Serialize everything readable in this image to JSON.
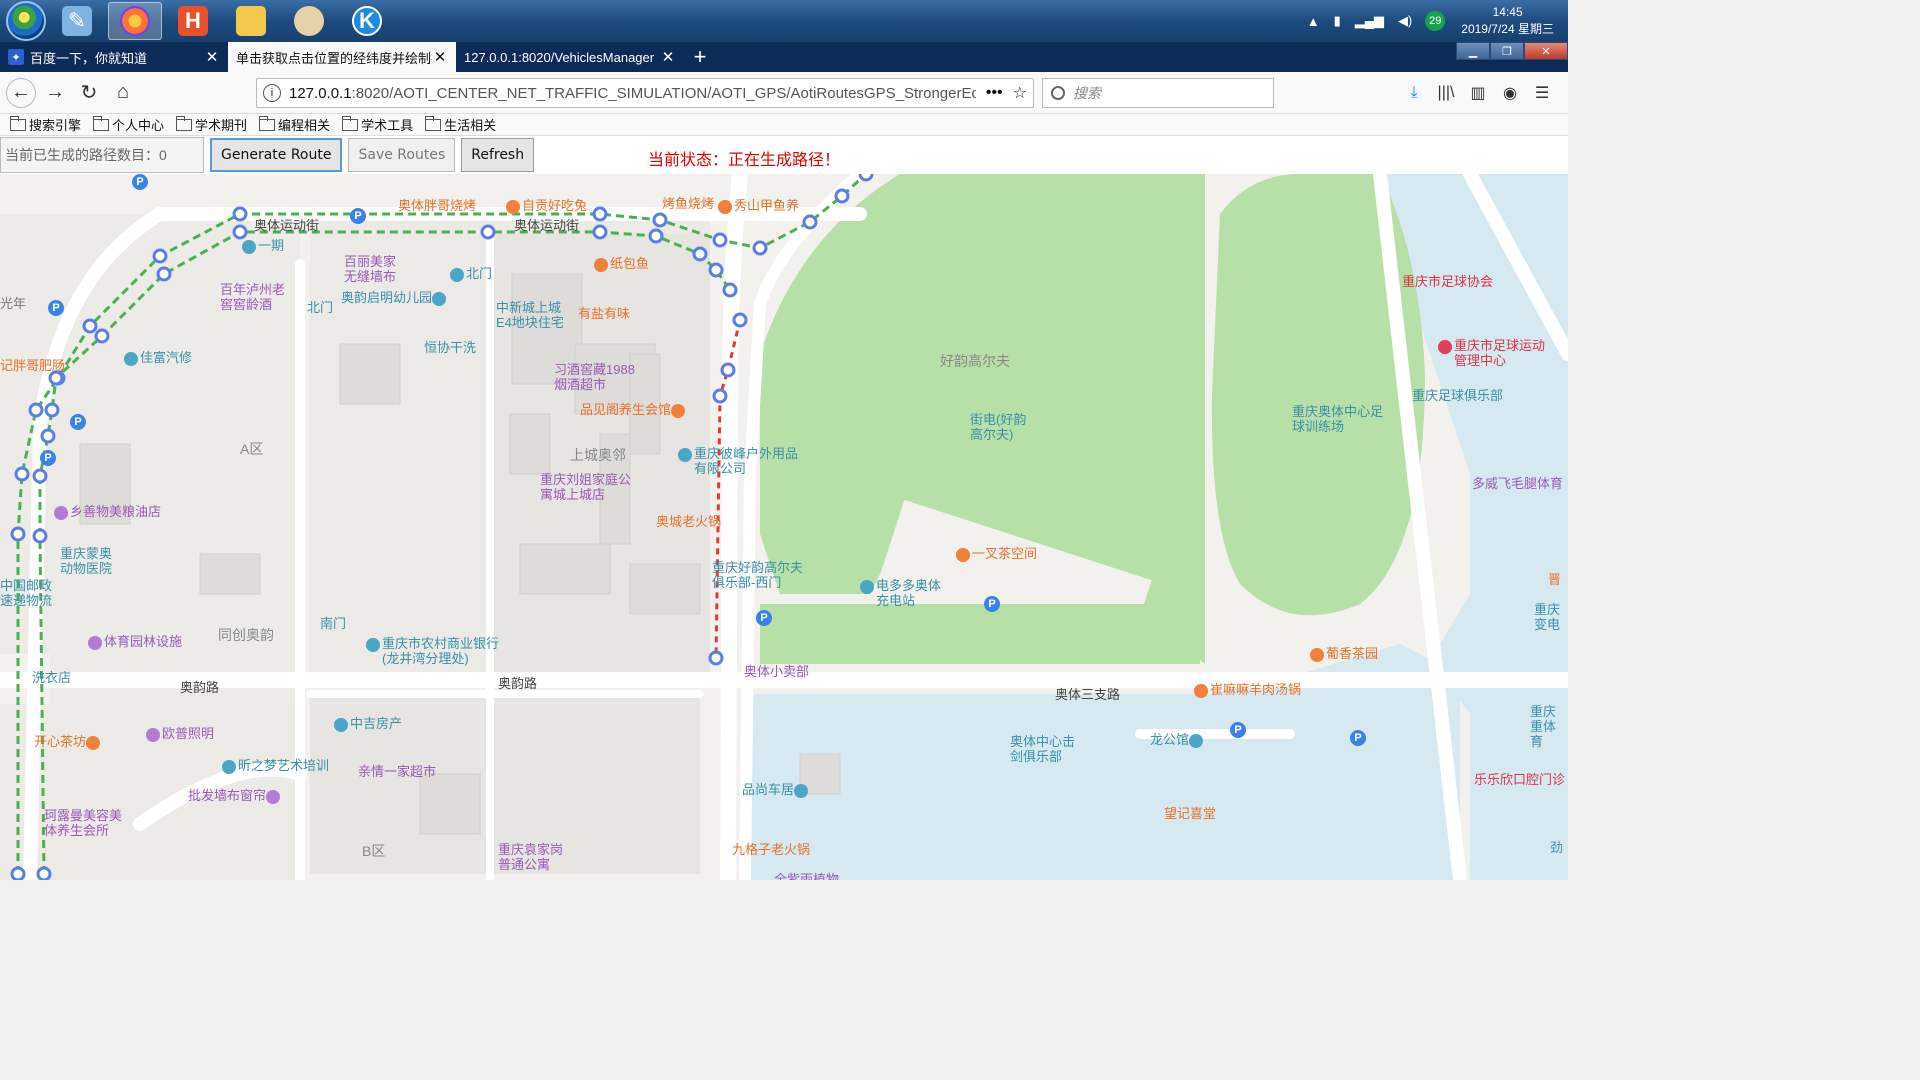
{
  "taskbar": {
    "clock_time": "14:45",
    "clock_date": "2019/7/24 星期三",
    "notification_count": "29",
    "apps": [
      "notepad",
      "firefox",
      "hbuilder",
      "file-explorer",
      "paint",
      "kuaizip"
    ]
  },
  "tabs": [
    {
      "label": "百度一下，你就知道",
      "favicon": "baidu-paw-icon"
    },
    {
      "label": "单击获取点击位置的经纬度并绘制折线",
      "favicon": ""
    },
    {
      "label": "127.0.0.1:8020/VehiclesManager",
      "favicon": ""
    }
  ],
  "nav": {
    "url_host": "127.0.0.1",
    "url_rest": ":8020/AOTI_CENTER_NET_TRAFFIC_SIMULATION/AOTI_GPS/AotiRoutesGPS_StrongerEdi",
    "search_placeholder": "搜索"
  },
  "bookmarks": [
    "搜索引擎",
    "个人中心",
    "学术期刊",
    "编程相关",
    "学术工具",
    "生活相关"
  ],
  "controls": {
    "route_count": "当前已生成的路径数目：0",
    "generate_label": "Generate Route",
    "save_label": "Save Routes",
    "refresh_label": "Refresh",
    "status": "当前状态：正在生成路径！"
  },
  "map": {
    "roads": [
      "奥体运动街",
      "奥体运动街",
      "奥韵路",
      "奥韵路",
      "奥体三支路"
    ],
    "districts": [
      "A区",
      "上城奥邻",
      "同创奥韵",
      "B区",
      "好韵高尔夫"
    ],
    "pois": [
      {
        "text": "奥体胖哥烧烤",
        "color": "orange"
      },
      {
        "text": "自贡好吃兔",
        "color": "orange"
      },
      {
        "text": "烤鱼烧烤",
        "color": "orange"
      },
      {
        "text": "秀山甲鱼养",
        "color": "orange"
      },
      {
        "text": "一期",
        "color": "teal"
      },
      {
        "text": "百丽美家无缝墙布",
        "color": "purple"
      },
      {
        "text": "北门",
        "color": "teal"
      },
      {
        "text": "纸包鱼",
        "color": "orange"
      },
      {
        "text": "百年泸州老窖窖龄酒",
        "color": "purple"
      },
      {
        "text": "北门",
        "color": "teal"
      },
      {
        "text": "奥韵启明幼儿园",
        "color": "teal"
      },
      {
        "text": "中新城上城E4地块住宅",
        "color": "teal"
      },
      {
        "text": "有盐有味",
        "color": "orange"
      },
      {
        "text": "恒协干洗",
        "color": "teal"
      },
      {
        "text": "佳富汽修",
        "color": "teal"
      },
      {
        "text": "记胖哥肥肠",
        "color": "orange"
      },
      {
        "text": "光年",
        "color": "gray"
      },
      {
        "text": "习酒窖藏1988烟酒超市",
        "color": "purple"
      },
      {
        "text": "品见阁养生会馆",
        "color": "orange"
      },
      {
        "text": "重庆彼峰户外用品有限公司",
        "color": "teal"
      },
      {
        "text": "重庆刘姐家庭公寓城上城店",
        "color": "purple"
      },
      {
        "text": "奥城老火锅",
        "color": "orange"
      },
      {
        "text": "乡善物美粮油店",
        "color": "purple"
      },
      {
        "text": "重庆蒙奥动物医院",
        "color": "teal"
      },
      {
        "text": "中国邮政速递物流",
        "color": "teal"
      },
      {
        "text": "重庆好韵高尔夫俱乐部-西门",
        "color": "teal"
      },
      {
        "text": "电多多奥体充电站",
        "color": "teal"
      },
      {
        "text": "一叉茶空间",
        "color": "orange"
      },
      {
        "text": "南门",
        "color": "teal"
      },
      {
        "text": "重庆市农村商业银行(龙井湾分理处)",
        "color": "teal"
      },
      {
        "text": "体育园林设施",
        "color": "purple"
      },
      {
        "text": "洗衣店",
        "color": "teal"
      },
      {
        "text": "奥体小卖部",
        "color": "purple"
      },
      {
        "text": "中吉房产",
        "color": "teal"
      },
      {
        "text": "开心茶坊",
        "color": "orange"
      },
      {
        "text": "欧普照明",
        "color": "purple"
      },
      {
        "text": "亲情一家超市",
        "color": "purple"
      },
      {
        "text": "昕之梦艺术培训",
        "color": "teal"
      },
      {
        "text": "批发墙布窗帘",
        "color": "purple"
      },
      {
        "text": "珂露曼美容美体养生会所",
        "color": "purple"
      },
      {
        "text": "重庆袁家岗普通公寓",
        "color": "purple"
      },
      {
        "text": "品尚车居",
        "color": "teal"
      },
      {
        "text": "九格子老火锅",
        "color": "orange"
      },
      {
        "text": "全紫雨植物",
        "color": "purple"
      },
      {
        "text": "街电(好韵高尔夫)",
        "color": "teal"
      },
      {
        "text": "重庆奥体中心足球训练场",
        "color": "teal"
      },
      {
        "text": "重庆市足球协会",
        "color": "red"
      },
      {
        "text": "重庆市足球运动管理中心",
        "color": "red"
      },
      {
        "text": "重庆足球俱乐部",
        "color": "teal"
      },
      {
        "text": "多威飞毛腿体育",
        "color": "purple"
      },
      {
        "text": "葡香茶园",
        "color": "orange"
      },
      {
        "text": "崔嘛嘛羊肉汤锅",
        "color": "orange"
      },
      {
        "text": "奥体中心击剑俱乐部",
        "color": "teal"
      },
      {
        "text": "龙公馆",
        "color": "teal"
      },
      {
        "text": "望记喜堂",
        "color": "orange"
      },
      {
        "text": "乐乐欣口腔门诊",
        "color": "red"
      },
      {
        "text": "重庆重体育",
        "color": "teal"
      },
      {
        "text": "重庆变电",
        "color": "teal"
      },
      {
        "text": "晋",
        "color": "orange"
      },
      {
        "text": "劲",
        "color": "teal"
      }
    ]
  }
}
